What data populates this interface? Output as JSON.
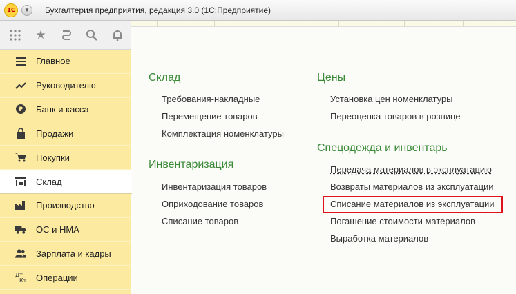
{
  "window": {
    "logo_text": "1С",
    "title": "Бухгалтерия предприятия, редакция 3.0  (1С:Предприятие)"
  },
  "toolbar": {
    "icons": [
      "apps-grid-icon",
      "star-icon",
      "history-icon",
      "search-icon",
      "bell-icon"
    ]
  },
  "sidebar": {
    "items": [
      {
        "label": "Главное",
        "icon": "menu-lines-icon"
      },
      {
        "label": "Руководителю",
        "icon": "trend-icon"
      },
      {
        "label": "Банк и касса",
        "icon": "ruble-coin-icon"
      },
      {
        "label": "Продажи",
        "icon": "shopping-bag-icon"
      },
      {
        "label": "Покупки",
        "icon": "cart-icon"
      },
      {
        "label": "Склад",
        "icon": "warehouse-icon",
        "active": true
      },
      {
        "label": "Производство",
        "icon": "factory-icon"
      },
      {
        "label": "ОС и НМА",
        "icon": "truck-icon"
      },
      {
        "label": "Зарплата и кадры",
        "icon": "people-icon"
      },
      {
        "label": "Операции",
        "icon": "debit-credit-icon"
      }
    ]
  },
  "content": {
    "sklad": {
      "title": "Склад",
      "links": [
        "Требования-накладные",
        "Перемещение товаров",
        "Комплектация номенклатуры"
      ]
    },
    "inventarizaciya": {
      "title": "Инвентаризация",
      "links": [
        "Инвентаризация товаров",
        "Оприходование товаров",
        "Списание товаров"
      ]
    },
    "ceny": {
      "title": "Цены",
      "links": [
        "Установка цен номенклатуры",
        "Переоценка товаров в рознице"
      ]
    },
    "specodezhda": {
      "title": "Спецодежда и инвентарь",
      "links": [
        "Передача материалов в эксплуатацию",
        "Возвраты материалов из эксплуатации",
        "Списание материалов из эксплуатации",
        "Погашение стоимости материалов",
        "Выработка материалов"
      ]
    }
  },
  "colors": {
    "sidebar_bg": "#fbeaa0",
    "group_title": "#3a8a38",
    "highlight": "#e0131c"
  }
}
